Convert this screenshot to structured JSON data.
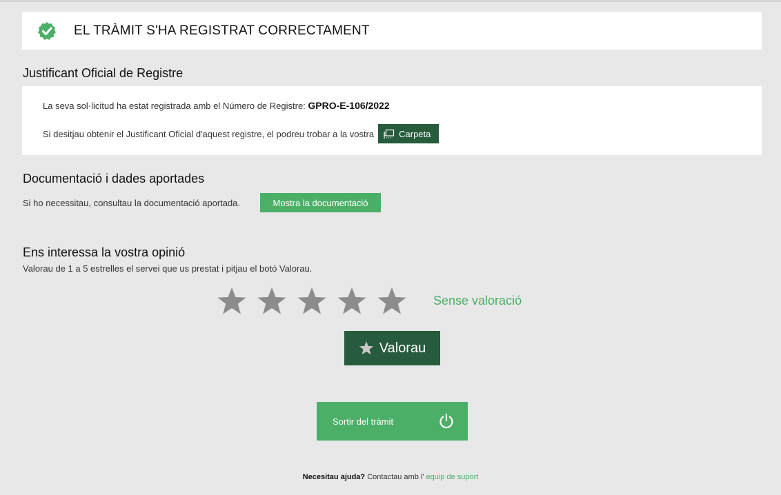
{
  "banner": {
    "title": "EL TRÀMIT S'HA REGISTRAT CORRECTAMENT",
    "icon": "check-circle-icon",
    "icon_color": "#4caf68"
  },
  "registry": {
    "section_title": "Justificant Oficial de Registre",
    "line1_text": "La seva sol·licitud ha estat registrada amb el Número de Registre:",
    "registry_number": "GPRO-E-106/2022",
    "line2_text": "Si desitjau obtenir el Justificant Oficial d'aquest registre, el podreu trobar a la vostra",
    "carpeta_label": "Carpeta",
    "carpeta_icon": "folder-icon"
  },
  "documentation": {
    "section_title": "Documentació i dades aportades",
    "text": "Si ho necessitau, consultau la documentació aportada.",
    "button_label": "Mostra la documentació"
  },
  "opinion": {
    "section_title": "Ens interessa la vostra opinió",
    "text": "Valorau de 1 a 5 estrelles el servei que us prestat i pitjau el botó Valorau.",
    "stars_total": 5,
    "stars_selected": 0,
    "rating_status": "Sense valoració",
    "rate_button_label": "Valorau"
  },
  "exit": {
    "label": "Sortir del tràmit",
    "icon": "power-icon"
  },
  "footer": {
    "help_bold": "Necesitau ajuda?",
    "help_text": "Contactau amb l'",
    "support_link": "equip de suport"
  },
  "colors": {
    "accent_green": "#4caf68",
    "dark_green": "#275b3d",
    "background": "#e8e8e8",
    "star_inactive": "#8c8c8c"
  }
}
